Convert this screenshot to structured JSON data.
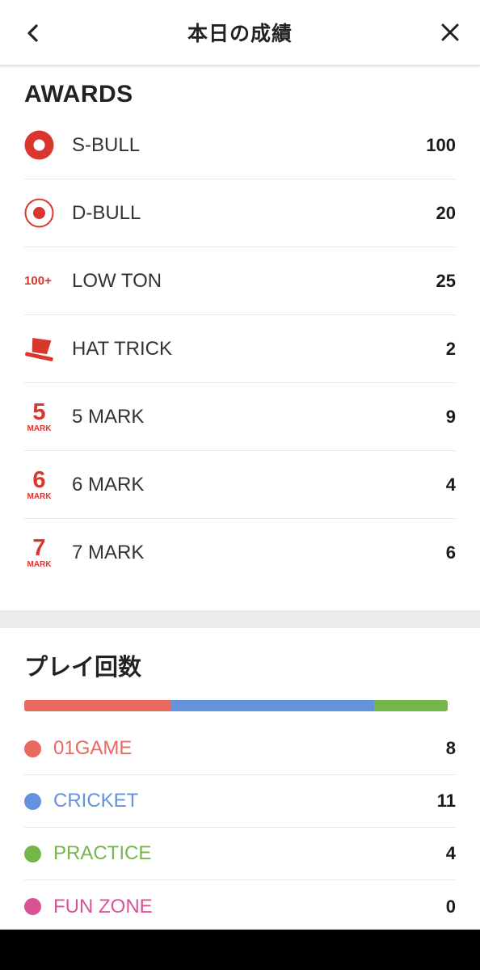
{
  "header": {
    "title": "本日の成績"
  },
  "awards": {
    "title": "AWARDS",
    "items": [
      {
        "icon": "s-bull-icon",
        "label": "S-BULL",
        "value": "100"
      },
      {
        "icon": "d-bull-icon",
        "label": "D-BULL",
        "value": "20"
      },
      {
        "icon": "low-ton-icon",
        "icon_text": "100+",
        "label": "LOW TON",
        "value": "25"
      },
      {
        "icon": "hat-icon",
        "label": "HAT TRICK",
        "value": "2"
      },
      {
        "icon": "five-mark-icon",
        "icon_num": "5",
        "icon_text": "MARK",
        "label": "5 MARK",
        "value": "9"
      },
      {
        "icon": "six-mark-icon",
        "icon_num": "6",
        "icon_text": "MARK",
        "label": "6 MARK",
        "value": "4"
      },
      {
        "icon": "seven-mark-icon",
        "icon_num": "7",
        "icon_text": "MARK",
        "label": "7 MARK",
        "value": "6"
      }
    ]
  },
  "plays": {
    "title": "プレイ回数",
    "items": [
      {
        "label": "01GAME",
        "value": "8",
        "color": "#e8695f"
      },
      {
        "label": "CRICKET",
        "value": "11",
        "color": "#6593db"
      },
      {
        "label": "PRACTICE",
        "value": "4",
        "color": "#75b64a"
      },
      {
        "label": "FUN ZONE",
        "value": "0",
        "color": "#d95394"
      }
    ]
  },
  "colors": {
    "accent": "#d9362e"
  }
}
